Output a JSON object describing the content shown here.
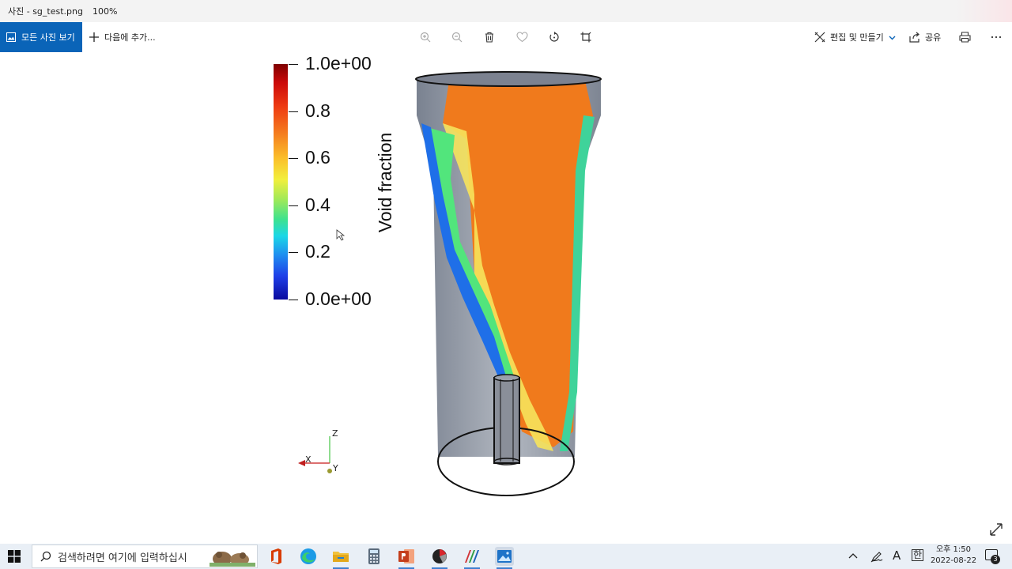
{
  "titlebar": {
    "app_name": "사진 - sg_test.png",
    "zoom": "100%"
  },
  "toolbar": {
    "all_photos_label": "모든 사진 보기",
    "add_to_label": "다음에 추가...",
    "edit_create_label": "편집 및 만들기",
    "share_label": "공유"
  },
  "colorbar": {
    "title": "Void fraction",
    "ticks": [
      {
        "label": "1.0e+00",
        "value": 1.0
      },
      {
        "label": "0.8",
        "value": 0.8
      },
      {
        "label": "0.6",
        "value": 0.6
      },
      {
        "label": "0.4",
        "value": 0.4
      },
      {
        "label": "0.2",
        "value": 0.2
      },
      {
        "label": "0.0e+00",
        "value": 0.0
      }
    ]
  },
  "axes": {
    "z": "Z",
    "x": "X",
    "y": "Y"
  },
  "taskbar": {
    "search_placeholder": "검색하려면 여기에 입력하십시",
    "ime": "A",
    "lang": "한",
    "time": "오후 1:50",
    "date": "2022-08-22",
    "notifications": "3"
  },
  "colors": {
    "accent": "#0a64b8",
    "taskbar": "#e9eff6"
  }
}
